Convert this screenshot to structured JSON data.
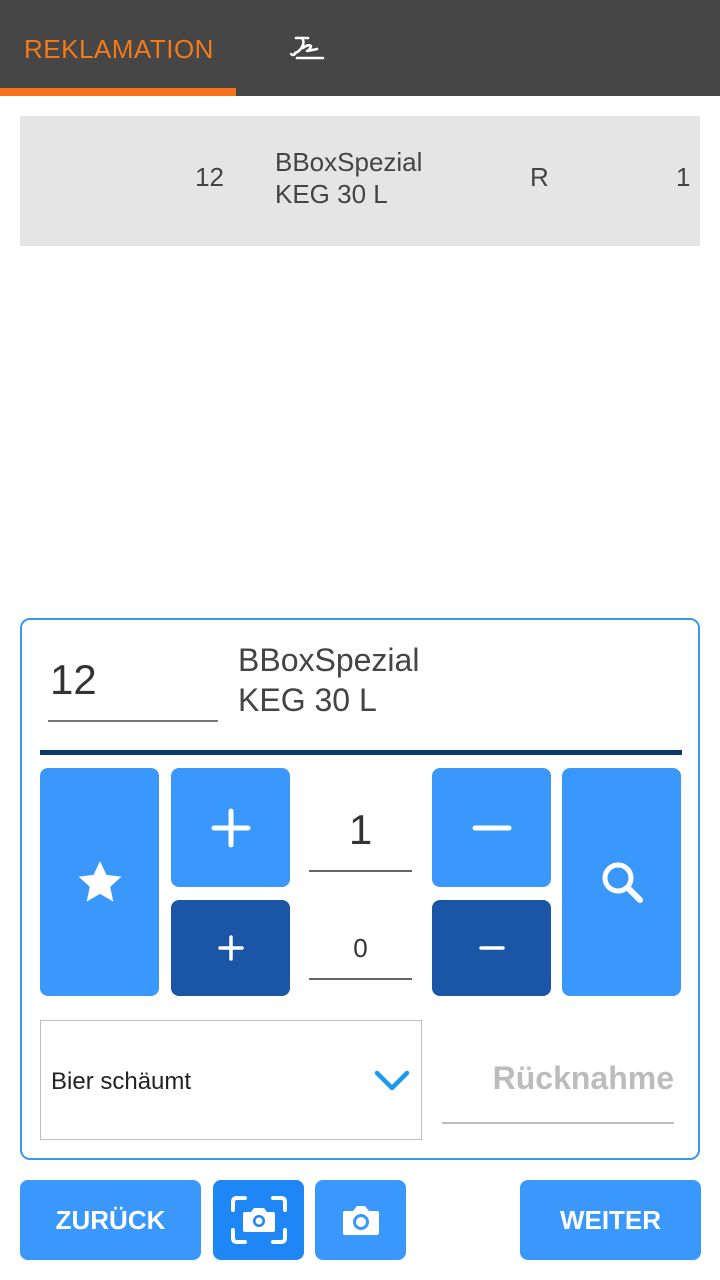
{
  "header": {
    "tabs": [
      {
        "label": "REKLAMATION",
        "active": true
      },
      {
        "icon": "signature-icon",
        "active": false
      }
    ],
    "colors": {
      "bar": "#464646",
      "accent": "#f7731b"
    }
  },
  "list": {
    "rows": [
      {
        "number": "12",
        "name_line1": "BBoxSpezial",
        "name_line2": "KEG 30 L",
        "code": "R",
        "quantity": "1"
      }
    ]
  },
  "detail": {
    "article_number": "12",
    "article_name_line1": "BBoxSpezial",
    "article_name_line2": "KEG 30 L",
    "counter_main": "1",
    "counter_secondary": "0",
    "reason": "Bier schäumt",
    "return_placeholder": "Rücknahme",
    "icons": {
      "favorite": "star-icon",
      "increase": "plus-icon",
      "decrease": "minus-icon",
      "search": "search-icon",
      "dropdown": "chevron-down-icon"
    }
  },
  "footer": {
    "back_label": "ZURÜCK",
    "next_label": "WEITER",
    "scan_icon": "scan-camera-icon",
    "camera_icon": "camera-icon"
  }
}
